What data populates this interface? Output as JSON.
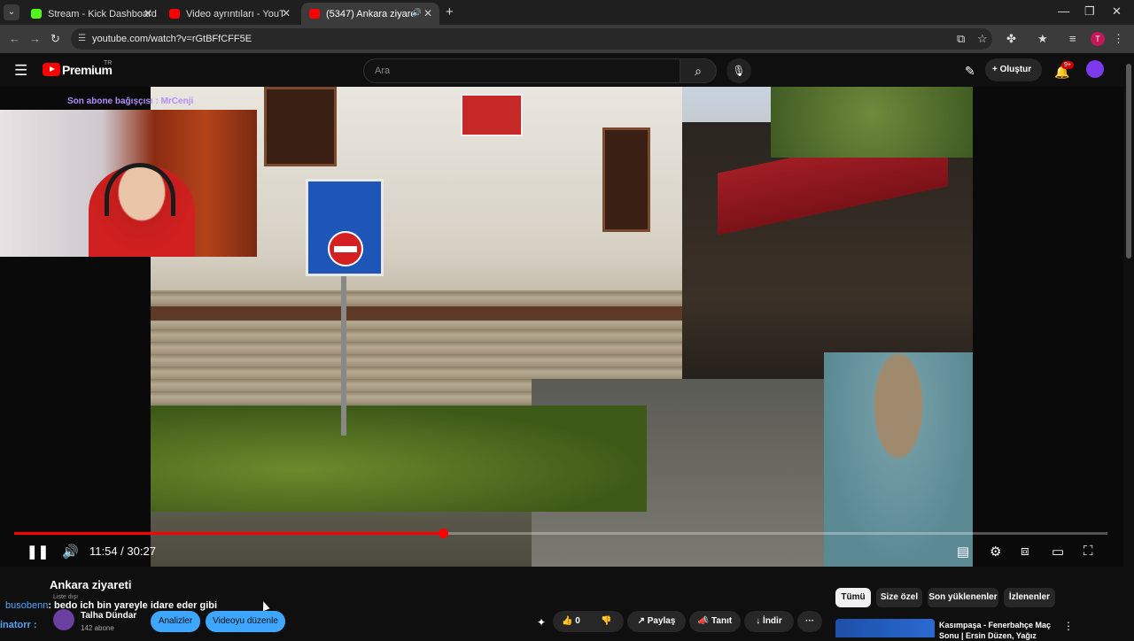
{
  "browser": {
    "tabs": [
      {
        "title": "Stream - Kick Dashboard",
        "favicon_color": "#53fc18",
        "close": "✕"
      },
      {
        "title": "Video ayrıntıları - YouTube Studi",
        "favicon_color": "#ff0000",
        "close": "✕"
      },
      {
        "title": "(5347) Ankara ziyareti - You",
        "favicon_color": "#ff0000",
        "close": "✕",
        "audio": "🔊"
      }
    ],
    "new_tab": "+",
    "url": "youtube.com/watch?v=rGtBFfCFF5E",
    "profile_initial": "T",
    "window_controls": {
      "minimize": "—",
      "maximize": "❐",
      "close": "✕"
    }
  },
  "youtube": {
    "logo_text": "Premium",
    "logo_sup": "TR",
    "search_placeholder": "Ara",
    "create_label": "Oluştur",
    "notification_count": "9+"
  },
  "player": {
    "overlay_text": "Son abone bağışçısı : MrCenji",
    "progress_fraction": 0.392,
    "time": "11:54 / 30:27"
  },
  "video_info": {
    "title": "Ankara ziyareti",
    "visibility": "Liste dışı",
    "chat_user": "busobenn",
    "chat_message": ": bedo ich bin yareyle idare eder gibi",
    "chat_user2": "inatorr :",
    "channel_name": "Talha Dündar",
    "subscribers": "142 abone",
    "analytics_button": "Analizler",
    "edit_button": "Videoyu düzenle",
    "like_count": "0",
    "share_label": "Paylaş",
    "promote_label": "Tanıt",
    "download_label": "İndir",
    "more_label": "···"
  },
  "chips": [
    "Tümü",
    "Size özel",
    "Son yüklenenler",
    "İzlenenler"
  ],
  "recommendation": {
    "title": "Kasımpaşa - Fenerbahçe Maç Sonu | Ersin Düzen, Yağız"
  }
}
